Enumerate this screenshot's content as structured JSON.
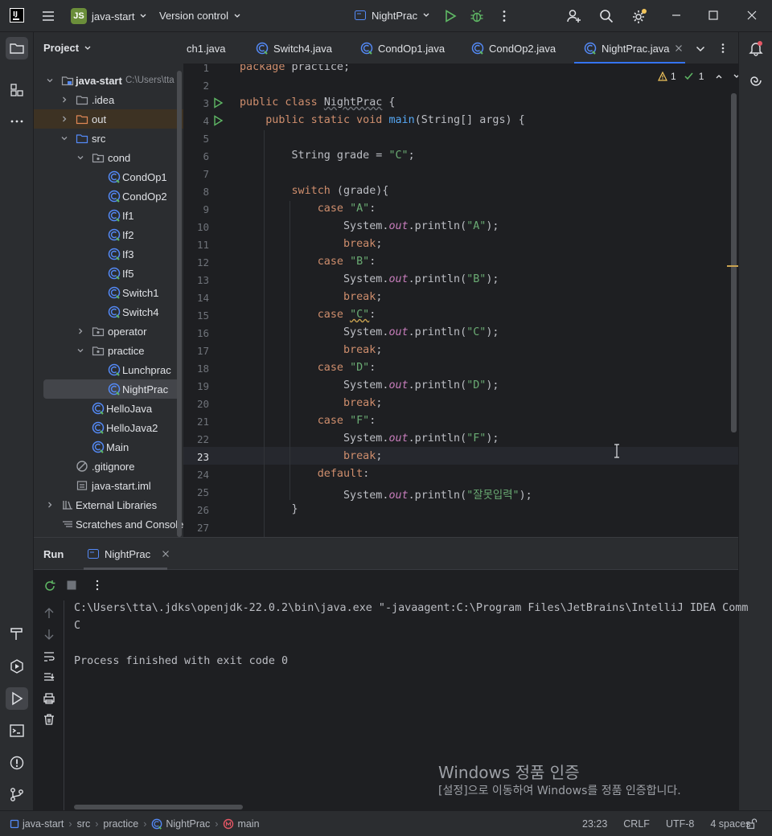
{
  "titlebar": {
    "project_initials": "JS",
    "project_name": "java-start",
    "vcs": "Version control",
    "run_config": "NightPrac"
  },
  "project_panel": {
    "title": "Project",
    "root_name": "java-start",
    "root_path": "C:\\Users\\tta",
    "items": [
      {
        "label": "java-start"
      },
      {
        "label": ".idea"
      },
      {
        "label": "out"
      },
      {
        "label": "src"
      },
      {
        "label": "cond"
      },
      {
        "label": "CondOp1"
      },
      {
        "label": "CondOp2"
      },
      {
        "label": "If1"
      },
      {
        "label": "If2"
      },
      {
        "label": "If3"
      },
      {
        "label": "If5"
      },
      {
        "label": "Switch1"
      },
      {
        "label": "Switch4"
      },
      {
        "label": "operator"
      },
      {
        "label": "practice"
      },
      {
        "label": "Lunchprac"
      },
      {
        "label": "NightPrac"
      },
      {
        "label": "HelloJava"
      },
      {
        "label": "HelloJava2"
      },
      {
        "label": "Main"
      },
      {
        "label": ".gitignore"
      },
      {
        "label": "java-start.iml"
      },
      {
        "label": "External Libraries"
      },
      {
        "label": "Scratches and Consoles"
      }
    ]
  },
  "tabs": [
    {
      "label": "ch1.java"
    },
    {
      "label": "Switch4.java"
    },
    {
      "label": "CondOp1.java"
    },
    {
      "label": "CondOp2.java"
    },
    {
      "label": "NightPrac.java"
    }
  ],
  "editor": {
    "warnings": "1",
    "weak_warnings": "1",
    "line_numbers": [
      "1",
      "2",
      "3",
      "4",
      "5",
      "6",
      "7",
      "8",
      "9",
      "10",
      "11",
      "12",
      "13",
      "14",
      "15",
      "16",
      "17",
      "18",
      "19",
      "20",
      "21",
      "22",
      "23",
      "24",
      "25",
      "26",
      "27"
    ],
    "current_line": "23"
  },
  "run_panel": {
    "title": "Run",
    "tab": "NightPrac",
    "console": [
      "C:\\Users\\tta\\.jdks\\openjdk-22.0.2\\bin\\java.exe \"-javaagent:C:\\Program Files\\JetBrains\\IntelliJ IDEA Comm",
      "C",
      "",
      "Process finished with exit code 0"
    ]
  },
  "watermark": {
    "title": "Windows 정품 인증",
    "subtitle": "[설정]으로 이동하여 Windows를 정품 인증합니다."
  },
  "statusbar": {
    "breadcrumbs": [
      "java-start",
      "src",
      "practice",
      "NightPrac",
      "main"
    ],
    "position": "23:23",
    "line_sep": "CRLF",
    "encoding": "UTF-8",
    "indent": "4 spaces"
  },
  "colors": {
    "accent": "#3574f0",
    "keyword": "#cf8e6d",
    "string": "#6aab73",
    "field": "#c77dbb",
    "run_green": "#5fb865"
  }
}
